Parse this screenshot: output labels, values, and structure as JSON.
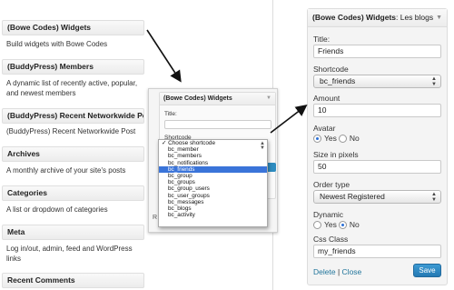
{
  "widgets": [
    {
      "title": "(Bowe Codes) Widgets",
      "desc": "Build widgets with Bowe Codes"
    },
    {
      "title": "(BuddyPress) Members",
      "desc": "A dynamic list of recently active, popular, and newest members"
    },
    {
      "title": "(BuddyPress) Recent Networkwide Post",
      "desc": "(BuddyPress) Recent Networkwide Post"
    },
    {
      "title": "Archives",
      "desc": "A monthly archive of your site's posts"
    },
    {
      "title": "Categories",
      "desc": "A list or dropdown of categories"
    },
    {
      "title": "Meta",
      "desc": "Log in/out, admin, feed and WordPress links"
    },
    {
      "title": "Recent Comments",
      "desc": ""
    }
  ],
  "overlay": {
    "title": "(Bowe Codes) Widgets",
    "title_label": "Title:",
    "shortcode_label": "Shortcode",
    "options": [
      "Choose shortcode",
      "bc_member",
      "bc_members",
      "bc_notifications",
      "bc_friends",
      "bc_group",
      "bc_groups",
      "bc_group_users",
      "bc_user_groups",
      "bc_messages",
      "bc_blogs",
      "bc_activity"
    ],
    "selected_option": "bc_friends",
    "checked_option": "Choose shortcode",
    "footer": "R"
  },
  "form": {
    "header_bold": "(Bowe Codes) Widgets",
    "header_rest": ": Les blogs",
    "title_label": "Title:",
    "title_value": "Friends",
    "shortcode_label": "Shortcode",
    "shortcode_value": "bc_friends",
    "amount_label": "Amount",
    "amount_value": "10",
    "avatar_label": "Avatar",
    "avatar_yes": "Yes",
    "avatar_no": "No",
    "avatar_selected": "Yes",
    "size_label": "Size in pixels",
    "size_value": "50",
    "order_label": "Order type",
    "order_value": "Newest Registered",
    "dynamic_label": "Dynamic",
    "dynamic_yes": "Yes",
    "dynamic_no": "No",
    "dynamic_selected": "No",
    "css_label": "Css Class",
    "css_value": "my_friends",
    "delete_label": "Delete",
    "separator": "|",
    "close_label": "Close",
    "save_label": "Save"
  },
  "icons": {
    "collapse": "triangle-down-icon",
    "select": "updown-arrows-icon",
    "arrow": "pointer-arrow-icon"
  },
  "colors": {
    "link": "#21759b",
    "save_button": "#2e86c1",
    "selected_option": "#3a74d9"
  }
}
